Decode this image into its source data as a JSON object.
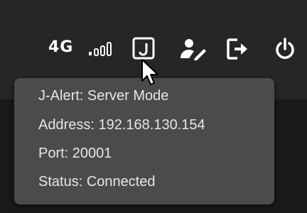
{
  "status_bar": {
    "network_type": "4G",
    "icons": [
      "signal-strength-icon",
      "j-alert-icon",
      "user-edit-icon",
      "logout-icon",
      "power-icon"
    ]
  },
  "tooltip": {
    "mode": "J-Alert: Server Mode",
    "address": "Address: 192.168.130.154",
    "port": "Port: 20001",
    "status": "Status: Connected"
  },
  "colors": {
    "top_bar": "#262626",
    "background": "#191919",
    "tooltip_bg": "#4b4b4b",
    "tooltip_text": "#e6e6e6",
    "icon": "#ffffff"
  }
}
